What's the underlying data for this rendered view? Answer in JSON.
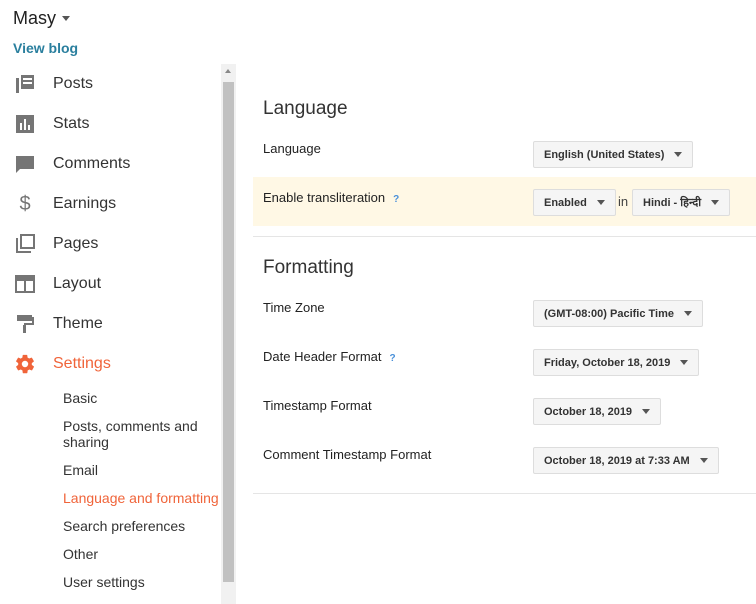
{
  "header": {
    "blog_name": "Masy",
    "view_blog": "View blog"
  },
  "nav": {
    "items": [
      {
        "label": "Posts",
        "icon": "posts-icon"
      },
      {
        "label": "Stats",
        "icon": "stats-icon"
      },
      {
        "label": "Comments",
        "icon": "comments-icon"
      },
      {
        "label": "Earnings",
        "icon": "dollar-icon"
      },
      {
        "label": "Pages",
        "icon": "pages-icon"
      },
      {
        "label": "Layout",
        "icon": "layout-icon"
      },
      {
        "label": "Theme",
        "icon": "paint-roller-icon"
      },
      {
        "label": "Settings",
        "icon": "gear-icon"
      }
    ],
    "sub_items": [
      "Basic",
      "Posts, comments and sharing",
      "Email",
      "Language and formatting",
      "Search preferences",
      "Other",
      "User settings"
    ]
  },
  "language_section": {
    "title": "Language",
    "language_label": "Language",
    "language_value": "English (United States)",
    "translit_label": "Enable transliteration",
    "translit_help": "?",
    "translit_value": "Enabled",
    "in_word": "in",
    "translit_lang": "Hindi - हिन्दी"
  },
  "formatting_section": {
    "title": "Formatting",
    "timezone_label": "Time Zone",
    "timezone_value": "(GMT-08:00) Pacific Time",
    "date_header_label": "Date Header Format",
    "date_header_help": "?",
    "date_header_value": "Friday, October 18, 2019",
    "timestamp_label": "Timestamp Format",
    "timestamp_value": "October 18, 2019",
    "comment_ts_label": "Comment Timestamp Format",
    "comment_ts_value": "October 18, 2019 at 7:33 AM"
  },
  "colors": {
    "accent": "#f0643a",
    "link": "#2a7f9e",
    "highlight_row": "#fff8e5"
  }
}
